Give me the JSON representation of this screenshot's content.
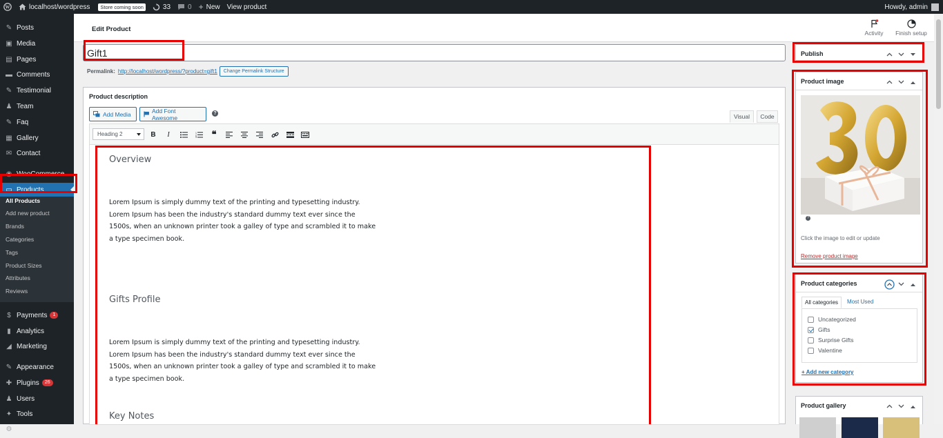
{
  "adminbar": {
    "site_name": "localhost/wordpress",
    "store_badge": "Store coming soon",
    "updates_count": "33",
    "comments_count": "0",
    "new_label": "New",
    "view_product": "View product",
    "howdy": "Howdy, admin"
  },
  "sidebar": {
    "items": [
      {
        "label": "Posts",
        "icon": "pin-icon"
      },
      {
        "label": "Media",
        "icon": "media-icon"
      },
      {
        "label": "Pages",
        "icon": "page-icon"
      },
      {
        "label": "Comments",
        "icon": "comment-icon"
      },
      {
        "label": "Testimonial",
        "icon": "testimonial-icon"
      },
      {
        "label": "Team",
        "icon": "team-icon"
      },
      {
        "label": "Faq",
        "icon": "faq-icon"
      },
      {
        "label": "Gallery",
        "icon": "gallery-icon"
      },
      {
        "label": "Contact",
        "icon": "contact-icon"
      },
      {
        "label": "WooCommerce",
        "icon": "woo-icon"
      },
      {
        "label": "Products",
        "icon": "products-icon"
      },
      {
        "label": "Payments",
        "icon": "payments-icon",
        "badge": "1"
      },
      {
        "label": "Analytics",
        "icon": "analytics-icon"
      },
      {
        "label": "Marketing",
        "icon": "marketing-icon"
      },
      {
        "label": "Appearance",
        "icon": "appearance-icon"
      },
      {
        "label": "Plugins",
        "icon": "plugins-icon",
        "badge": "26"
      },
      {
        "label": "Users",
        "icon": "users-icon"
      },
      {
        "label": "Tools",
        "icon": "tools-icon"
      },
      {
        "label": "Settings",
        "icon": "settings-icon"
      }
    ],
    "submenu": [
      "All Products",
      "Add new product",
      "Brands",
      "Categories",
      "Tags",
      "Product Sizes",
      "Attributes",
      "Reviews"
    ]
  },
  "header": {
    "title": "Edit Product",
    "activity": "Activity",
    "finish_setup": "Finish setup"
  },
  "product": {
    "title": "Gift1",
    "permalink_label": "Permalink:",
    "permalink_url": "http://localhost/wordpress/?product=gift1",
    "permalink_button": "Change Permalink Structure"
  },
  "description": {
    "box_title": "Product description",
    "add_media": "Add Media",
    "add_font_awesome": "Add Font Awesome",
    "tab_visual": "Visual",
    "tab_code": "Code",
    "format_select": "Heading 2",
    "content": {
      "h1": "Overview",
      "p1": "Lorem Ipsum is simply dummy text of the printing and typesetting industry. Lorem Ipsum has been the industry's standard dummy text ever since the 1500s, when an unknown printer took a galley of type and scrambled it to make a type specimen book.",
      "h2": "Gifts Profile",
      "p2": "Lorem Ipsum is simply dummy text of the printing and typesetting industry. Lorem Ipsum has been the industry's standard dummy text ever since the 1500s, when an unknown printer took a galley of type and scrambled it to make a type specimen book.",
      "h3": "Key Notes"
    }
  },
  "publish": {
    "title": "Publish"
  },
  "product_image": {
    "title": "Product image",
    "hint": "Click the image to edit or update",
    "remove": "Remove product image"
  },
  "categories": {
    "title": "Product categories",
    "tab_all": "All categories",
    "tab_most": "Most Used",
    "items": [
      {
        "label": "Uncategorized",
        "checked": false
      },
      {
        "label": "Gifts",
        "checked": true
      },
      {
        "label": "Surprise Gifts",
        "checked": false
      },
      {
        "label": "Valentine",
        "checked": false
      }
    ],
    "add_new": "+ Add new category"
  },
  "gallery": {
    "title": "Product gallery"
  },
  "colors": {
    "admin_dark": "#1d2327",
    "accent": "#2271b1",
    "highlight": "#e60000"
  }
}
